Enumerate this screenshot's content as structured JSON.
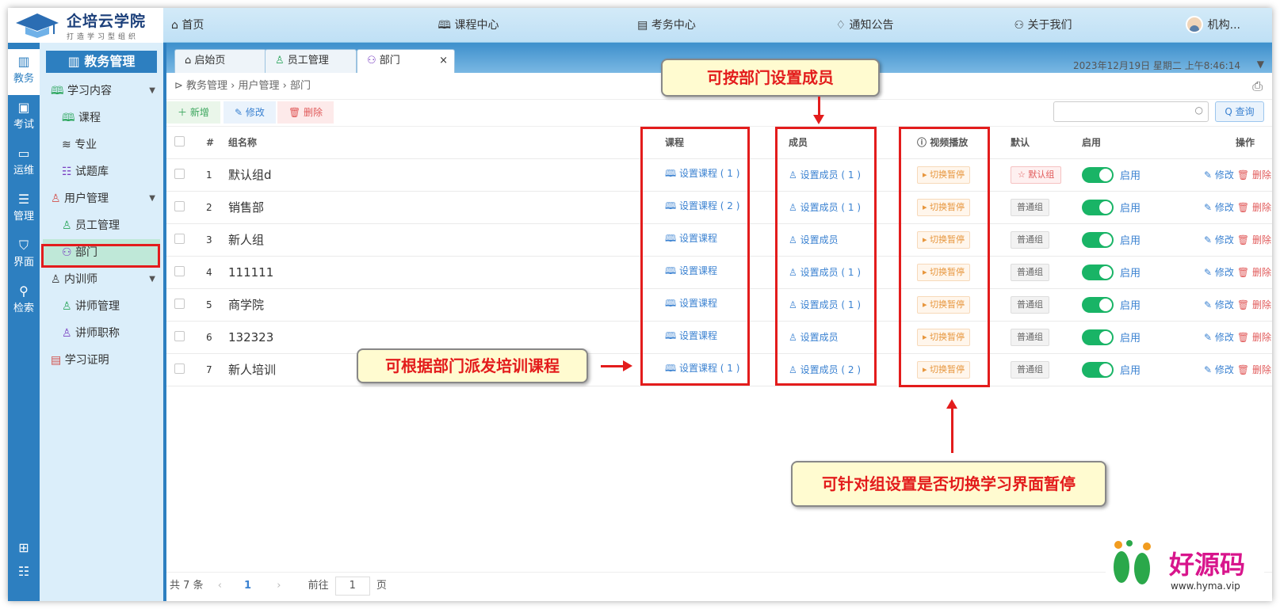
{
  "logo": {
    "title": "企培云学院",
    "subtitle": "打造学习型组织"
  },
  "topnav": [
    {
      "icon": "home-icon",
      "glyph": "⌂",
      "label": "首页"
    },
    {
      "icon": "course-center-icon",
      "glyph": "🕮",
      "label": "课程中心"
    },
    {
      "icon": "exam-center-icon",
      "glyph": "▤",
      "label": "考务中心"
    },
    {
      "icon": "notice-icon",
      "glyph": "♢",
      "label": "通知公告"
    },
    {
      "icon": "about-icon",
      "glyph": "⚇",
      "label": "关于我们"
    }
  ],
  "user": {
    "name": "机构..."
  },
  "iconbar": [
    {
      "label": "教务",
      "glyph": "▥",
      "active": true
    },
    {
      "label": "考试",
      "glyph": "▣"
    },
    {
      "label": "运维",
      "glyph": "▭"
    },
    {
      "label": "管理",
      "glyph": "☰"
    },
    {
      "label": "界面",
      "glyph": "⛉"
    },
    {
      "label": "检索",
      "glyph": "⚲"
    }
  ],
  "sidemenu": {
    "header": "教务管理",
    "items": [
      {
        "label": "学习内容",
        "level": 0,
        "expand": true
      },
      {
        "label": "课程",
        "level": 1
      },
      {
        "label": "专业",
        "level": 1
      },
      {
        "label": "试题库",
        "level": 1
      },
      {
        "label": "用户管理",
        "level": 0,
        "expand": true
      },
      {
        "label": "员工管理",
        "level": 1
      },
      {
        "label": "部门",
        "level": 1,
        "selected": true
      },
      {
        "label": "内训师",
        "level": 0,
        "expand": true
      },
      {
        "label": "讲师管理",
        "level": 1
      },
      {
        "label": "讲师职称",
        "level": 1
      },
      {
        "label": "学习证明",
        "level": 0
      }
    ]
  },
  "tabs": [
    {
      "label": "启始页"
    },
    {
      "label": "员工管理"
    },
    {
      "label": "部门",
      "active": true
    }
  ],
  "datetime": "2023年12月19日 星期二 上午8:46:14",
  "breadcrumb": "教务管理 › 用户管理 › 部门",
  "toolbar": {
    "add": "＋ 新增",
    "edit": "✎ 修改",
    "del": "🗑 删除",
    "query": "Q 查询"
  },
  "table": {
    "headers": {
      "num": "#",
      "name": "组名称",
      "course": "课程",
      "member": "成员",
      "video": "视频播放",
      "default": "默认",
      "enable": "启用",
      "ops": "操作"
    },
    "rows": [
      {
        "num": "1",
        "name": "默认组d",
        "course": "设置课程 ( 1 )",
        "member": "设置成员 ( 1 )",
        "video": "切换暂停",
        "default": "默认组",
        "isDefault": true,
        "enable": "启用",
        "edit": "修改",
        "del": "删除"
      },
      {
        "num": "2",
        "name": "销售部",
        "course": "设置课程 ( 2 )",
        "member": "设置成员 ( 1 )",
        "video": "切换暂停",
        "default": "普通组",
        "enable": "启用",
        "edit": "修改",
        "del": "删除"
      },
      {
        "num": "3",
        "name": "新人组",
        "course": "设置课程",
        "member": "设置成员",
        "video": "切换暂停",
        "default": "普通组",
        "enable": "启用",
        "edit": "修改",
        "del": "删除"
      },
      {
        "num": "4",
        "name": "111111",
        "course": "设置课程",
        "member": "设置成员 ( 1 )",
        "video": "切换暂停",
        "default": "普通组",
        "enable": "启用",
        "edit": "修改",
        "del": "删除"
      },
      {
        "num": "5",
        "name": "商学院",
        "course": "设置课程",
        "member": "设置成员 ( 1 )",
        "video": "切换暂停",
        "default": "普通组",
        "enable": "启用",
        "edit": "修改",
        "del": "删除"
      },
      {
        "num": "6",
        "name": "132323",
        "course": "设置课程",
        "member": "设置成员",
        "video": "切换暂停",
        "default": "普通组",
        "enable": "启用",
        "edit": "修改",
        "del": "删除"
      },
      {
        "num": "7",
        "name": "新人培训",
        "course": "设置课程 ( 1 )",
        "member": "设置成员 ( 2 )",
        "video": "切换暂停",
        "default": "普通组",
        "enable": "启用",
        "edit": "修改",
        "del": "删除"
      }
    ]
  },
  "pagination": {
    "total": "共 7 条",
    "current": "1",
    "goto": "前往",
    "page_value": "1",
    "page_unit": "页"
  },
  "annotations": {
    "member": "可按部门设置成员",
    "course": "可根据部门派发培训课程",
    "video": "可针对组设置是否切换学习界面暂停"
  },
  "watermark": {
    "text": "好源码",
    "url": "www.hyma.vip"
  },
  "colors": {
    "primary": "#2d7fc0",
    "accent_red": "#e31c1c",
    "switch_on": "#19b466"
  }
}
